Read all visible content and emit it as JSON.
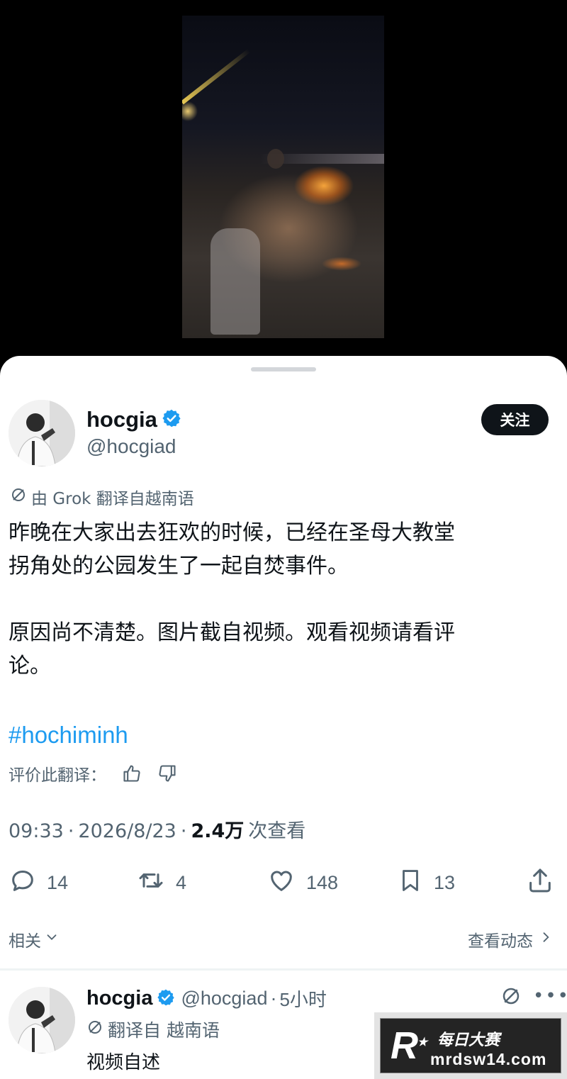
{
  "tweet": {
    "display_name": "hocgia",
    "handle": "@hocgiad",
    "follow_label": "关注",
    "translation_note": "由 Grok 翻译自越南语",
    "body": {
      "p1_line1": "昨晚在大家出去狂欢的时候，已经在圣母大教堂",
      "p1_line2": "拐角处的公园发生了一起自焚事件。",
      "p2_line1": "原因尚不清楚。图片截自视频。观看视频请看评",
      "p2_line2": "论。"
    },
    "hashtag": "#hochiminh",
    "rate_label": "评价此翻译：",
    "time": "09:33",
    "date": "2026/8/23",
    "views": "2.4万",
    "views_label": "次查看",
    "dot": "·",
    "actions": {
      "replies": "14",
      "reposts": "4",
      "likes": "148",
      "bookmarks": "13"
    },
    "related_label": "相关",
    "view_activity_label": "查看动态"
  },
  "reply": {
    "display_name": "hocgia",
    "handle": "@hocgiad",
    "time": "5小时",
    "translate_label": "翻译自 越南语",
    "text": "视频自述"
  },
  "watermark": {
    "logo_letter": "R",
    "brand_cn": "每日大赛",
    "url": "mrdsw14.com"
  },
  "colors": {
    "verified": "#1d9bf0",
    "hashtag": "#1d9bf0",
    "follow_bg": "#0f1419",
    "muted": "#536471"
  },
  "icons": [
    "grok-icon",
    "verified-icon",
    "thumbs-up-icon",
    "thumbs-down-icon",
    "reply-icon",
    "repost-icon",
    "like-icon",
    "bookmark-icon",
    "share-icon",
    "chevron-down-icon",
    "chevron-right-icon",
    "more-icon"
  ]
}
